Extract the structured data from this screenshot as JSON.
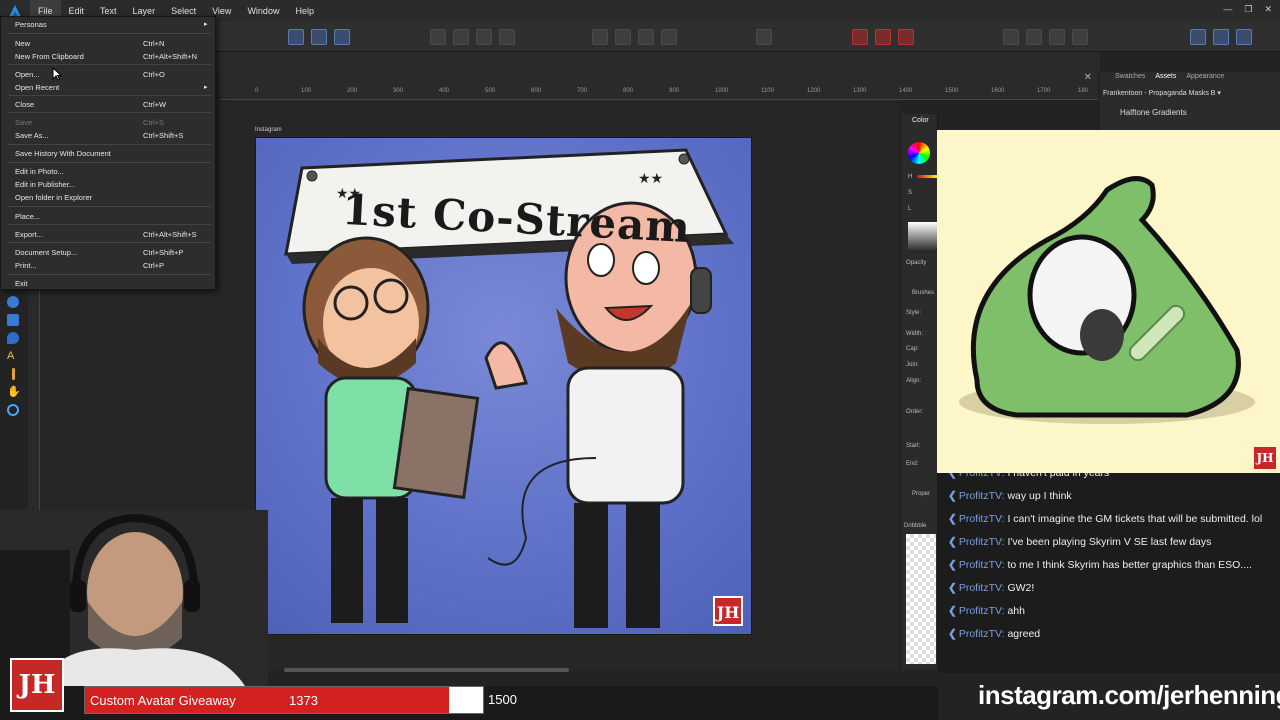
{
  "menubar": {
    "items": [
      "File",
      "Edit",
      "Text",
      "Layer",
      "Select",
      "View",
      "Window",
      "Help"
    ],
    "active": "File"
  },
  "file_menu": {
    "items": [
      {
        "label": "Personas",
        "shortcut": "",
        "submenu": true,
        "disabled": false
      },
      {
        "label": "New",
        "shortcut": "Ctrl+N",
        "submenu": false,
        "disabled": false
      },
      {
        "label": "New From Clipboard",
        "shortcut": "Ctrl+Alt+Shift+N",
        "submenu": false,
        "disabled": false
      },
      {
        "label": "Open...",
        "shortcut": "Ctrl+O",
        "submenu": false,
        "disabled": false
      },
      {
        "label": "Open Recent",
        "shortcut": "",
        "submenu": true,
        "disabled": false
      },
      {
        "label": "Close",
        "shortcut": "Ctrl+W",
        "submenu": false,
        "disabled": false
      },
      {
        "label": "Save",
        "shortcut": "Ctrl+S",
        "submenu": false,
        "disabled": true
      },
      {
        "label": "Save As...",
        "shortcut": "Ctrl+Shift+S",
        "submenu": false,
        "disabled": false
      },
      {
        "label": "Save History With Document",
        "shortcut": "",
        "submenu": false,
        "disabled": false
      },
      {
        "label": "Edit in Photo...",
        "shortcut": "",
        "submenu": false,
        "disabled": false
      },
      {
        "label": "Edit in Publisher...",
        "shortcut": "",
        "submenu": false,
        "disabled": false
      },
      {
        "label": "Open folder in Explorer",
        "shortcut": "",
        "submenu": false,
        "disabled": false
      },
      {
        "label": "Place...",
        "shortcut": "",
        "submenu": false,
        "disabled": false
      },
      {
        "label": "Export...",
        "shortcut": "Ctrl+Alt+Shift+S",
        "submenu": false,
        "disabled": false
      },
      {
        "label": "Document Setup...",
        "shortcut": "Ctrl+Shift+P",
        "submenu": false,
        "disabled": false
      },
      {
        "label": "Print...",
        "shortcut": "Ctrl+P",
        "submenu": false,
        "disabled": false
      },
      {
        "label": "Exit",
        "shortcut": "",
        "submenu": false,
        "disabled": false
      }
    ]
  },
  "ruler": {
    "ticks": [
      "0",
      "100",
      "200",
      "300",
      "400",
      "500",
      "600",
      "700",
      "800",
      "900",
      "1000",
      "1100",
      "1200",
      "1300",
      "1400",
      "1500",
      "1600",
      "1700",
      "180"
    ]
  },
  "artboard": {
    "label": "Instagram",
    "banner_text": "1st Co-Stream",
    "logo": "JH"
  },
  "right_panel": {
    "tabs": [
      "Swatches",
      "Assets",
      "Appearance"
    ],
    "active_tab": "Assets",
    "asset_set": "Frankentoon - Propaganda Masks B",
    "category": "Halftone Gradients"
  },
  "side_panel": {
    "color_title": "Color",
    "labels": [
      "H",
      "S",
      "L",
      "Opacity",
      "Brushes",
      "Style:",
      "Width:",
      "Cap:",
      "Join:",
      "Align:",
      "Order:",
      "Start:",
      "End:",
      "Proper",
      "Dribbble"
    ]
  },
  "chat": {
    "messages": [
      {
        "user": "ProfitzTV",
        "text": "I haven't paid in years"
      },
      {
        "user": "ProfitzTV",
        "text": "way up I think"
      },
      {
        "user": "ProfitzTV",
        "text": "I can't imagine the GM tickets that will be submitted. lol"
      },
      {
        "user": "ProfitzTV",
        "text": "I've been playing Skyrim V SE last few days"
      },
      {
        "user": "ProfitzTV",
        "text": "to me I think Skyrim has better graphics than ESO...."
      },
      {
        "user": "ProfitzTV",
        "text": "GW2!"
      },
      {
        "user": "ProfitzTV",
        "text": "ahh"
      },
      {
        "user": "ProfitzTV",
        "text": "agreed"
      }
    ]
  },
  "overlay": {
    "logo": "JH",
    "giveaway_label": "Custom Avatar Giveaway",
    "giveaway_count": "1373",
    "giveaway_goal": "1500",
    "giveaway_progress": 0.915,
    "instagram": "instagram.com/jerhenning"
  },
  "colors": {
    "accent_red": "#d32020",
    "chat_user": "#7b9fe0",
    "artboard_bg": "#5f72c9"
  }
}
